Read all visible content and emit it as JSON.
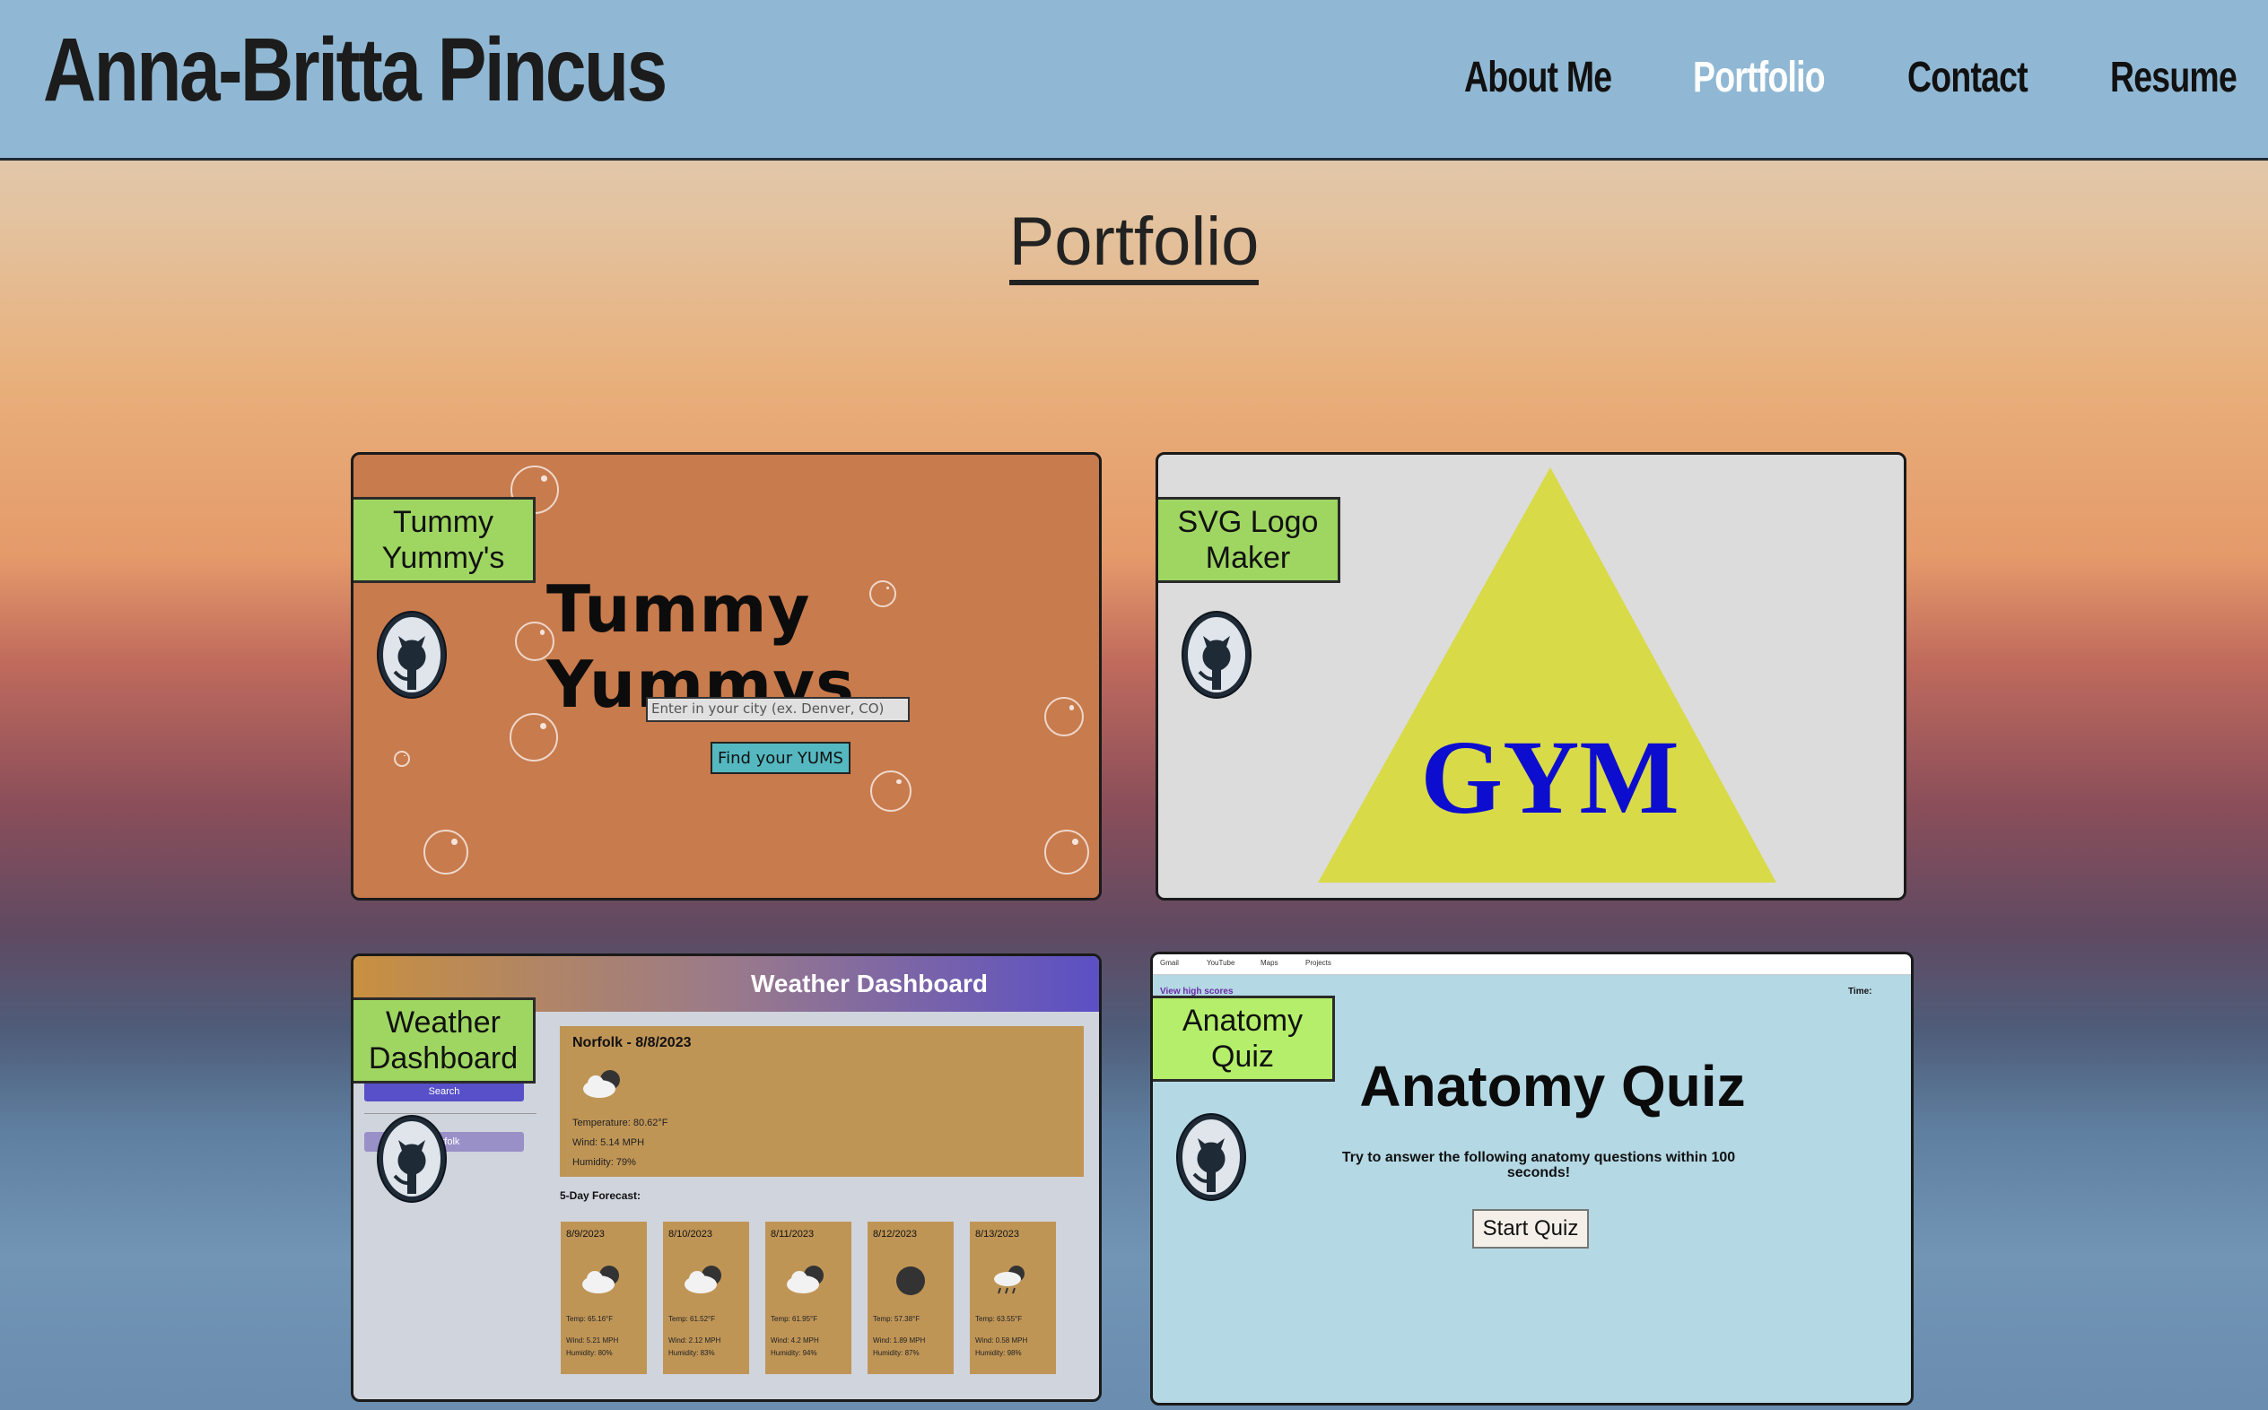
{
  "header": {
    "site_title": "Anna-Britta Pincus",
    "nav": [
      {
        "label": "About Me",
        "active": false
      },
      {
        "label": "Portfolio",
        "active": true
      },
      {
        "label": "Contact",
        "active": false
      },
      {
        "label": "Resume",
        "active": false
      }
    ]
  },
  "page": {
    "heading": "Portfolio"
  },
  "colors": {
    "header_bg": "#90b8d4",
    "label_bg": "#9fd662",
    "nav_active": "#ffffff"
  },
  "projects": [
    {
      "label_line1": "Tummy",
      "label_line2": "Yummy's",
      "icon": "github-icon",
      "preview": {
        "title": "Tummy Yummys",
        "input_placeholder": "Enter in your city (ex. Denver, CO)",
        "button": "Find your YUMS"
      }
    },
    {
      "label_line1": "SVG Logo",
      "label_line2": "Maker",
      "icon": "github-icon",
      "preview": {
        "logo_text": "GYM"
      }
    },
    {
      "label_line1": "Weather",
      "label_line2": "Dashboard",
      "icon": "github-icon",
      "preview": {
        "header": "Weather Dashboard",
        "search_button": "Search",
        "history_item": "Norfolk",
        "today": {
          "city_date": "Norfolk - 8/8/2023",
          "temp": "Temperature: 80.62°F",
          "wind": "Wind: 5.14 MPH",
          "humidity": "Humidity: 79%"
        },
        "forecast_title": "5-Day Forecast:",
        "forecast": [
          {
            "date": "8/9/2023",
            "temp": "Temp: 65.16°F",
            "wind": "Wind: 5.21 MPH",
            "humidity": "Humidity: 80%",
            "icon": "cloud-icon"
          },
          {
            "date": "8/10/2023",
            "temp": "Temp: 61.52°F",
            "wind": "Wind: 2.12 MPH",
            "humidity": "Humidity: 83%",
            "icon": "cloud-icon"
          },
          {
            "date": "8/11/2023",
            "temp": "Temp: 61.95°F",
            "wind": "Wind: 4.2 MPH",
            "humidity": "Humidity: 94%",
            "icon": "cloud-icon"
          },
          {
            "date": "8/12/2023",
            "temp": "Temp: 57.38°F",
            "wind": "Wind: 1.89 MPH",
            "humidity": "Humidity: 87%",
            "icon": "overcast-icon"
          },
          {
            "date": "8/13/2023",
            "temp": "Temp: 63.55°F",
            "wind": "Wind: 0.58 MPH",
            "humidity": "Humidity: 98%",
            "icon": "rain-cloud-icon"
          }
        ]
      }
    },
    {
      "label_line1": "Anatomy",
      "label_line2": "Quiz",
      "icon": "github-icon",
      "preview": {
        "bookmarks": [
          "Gmail",
          "YouTube",
          "Maps",
          "Projects"
        ],
        "high_scores": "View high scores",
        "time": "Time:",
        "title": "Anatomy Quiz",
        "subtitle": "Try to answer the following anatomy questions within 100 seconds!",
        "button": "Start Quiz"
      }
    }
  ]
}
